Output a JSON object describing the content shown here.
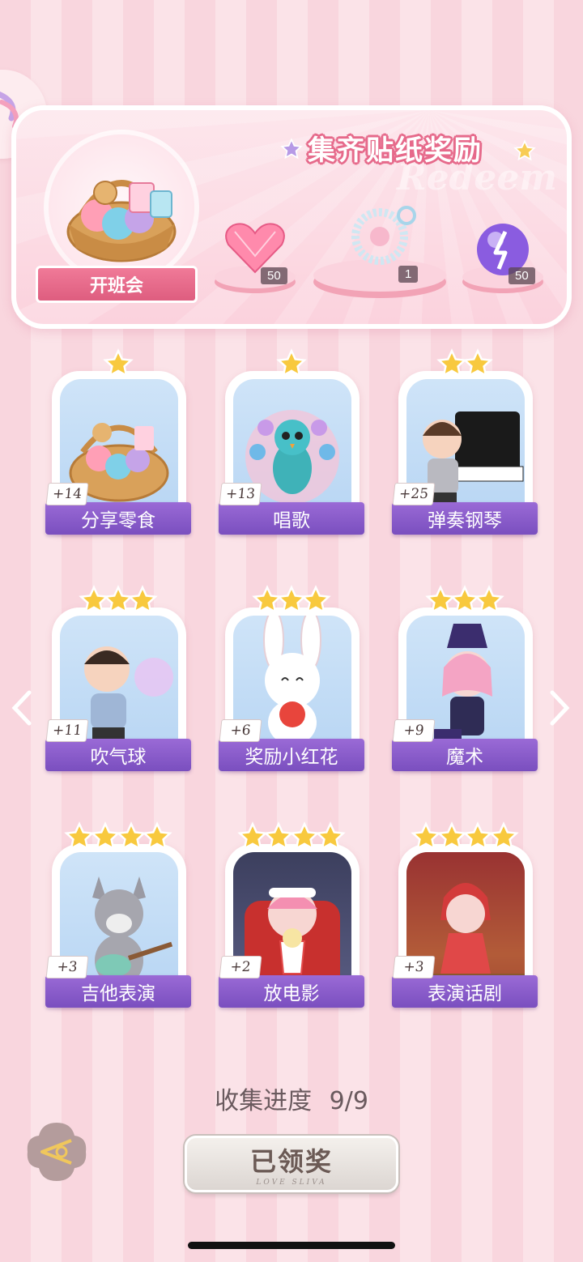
{
  "banner": {
    "title": "集齐贴纸奖励",
    "watermark": "Redeem",
    "event_label": "开班会",
    "rewards": [
      {
        "icon": "pink-heart-gem-icon",
        "count": "50"
      },
      {
        "icon": "pearl-bracelet-icon",
        "count": "1"
      },
      {
        "icon": "purple-energy-orb-icon",
        "count": "50"
      }
    ]
  },
  "cards": [
    {
      "label": "分享零食",
      "points": "+14",
      "stars": 1,
      "art": "snack-basket"
    },
    {
      "label": "唱歌",
      "points": "+13",
      "stars": 1,
      "art": "peacock-singing"
    },
    {
      "label": "弹奏钢琴",
      "points": "+25",
      "stars": 2,
      "art": "boy-piano"
    },
    {
      "label": "吹气球",
      "points": "+11",
      "stars": 3,
      "art": "boy-bubblegum"
    },
    {
      "label": "奖励小红花",
      "points": "+6",
      "stars": 3,
      "art": "bunny-flower"
    },
    {
      "label": "魔术",
      "points": "+9",
      "stars": 3,
      "art": "girl-magician"
    },
    {
      "label": "吉他表演",
      "points": "+3",
      "stars": 4,
      "art": "wolf-guitar"
    },
    {
      "label": "放电影",
      "points": "+2",
      "stars": 4,
      "art": "girl-popcorn"
    },
    {
      "label": "表演话剧",
      "points": "+3",
      "stars": 4,
      "art": "cat-girl-stage"
    }
  ],
  "progress": {
    "label": "收集进度",
    "value": "9/9"
  },
  "claim_button": {
    "label": "已领奖",
    "sub": "LOVE SLIVA"
  },
  "colors": {
    "accent_pink": "#e66a8b",
    "label_purple": "#8a5cc9",
    "star_gold": "#f7c744"
  }
}
